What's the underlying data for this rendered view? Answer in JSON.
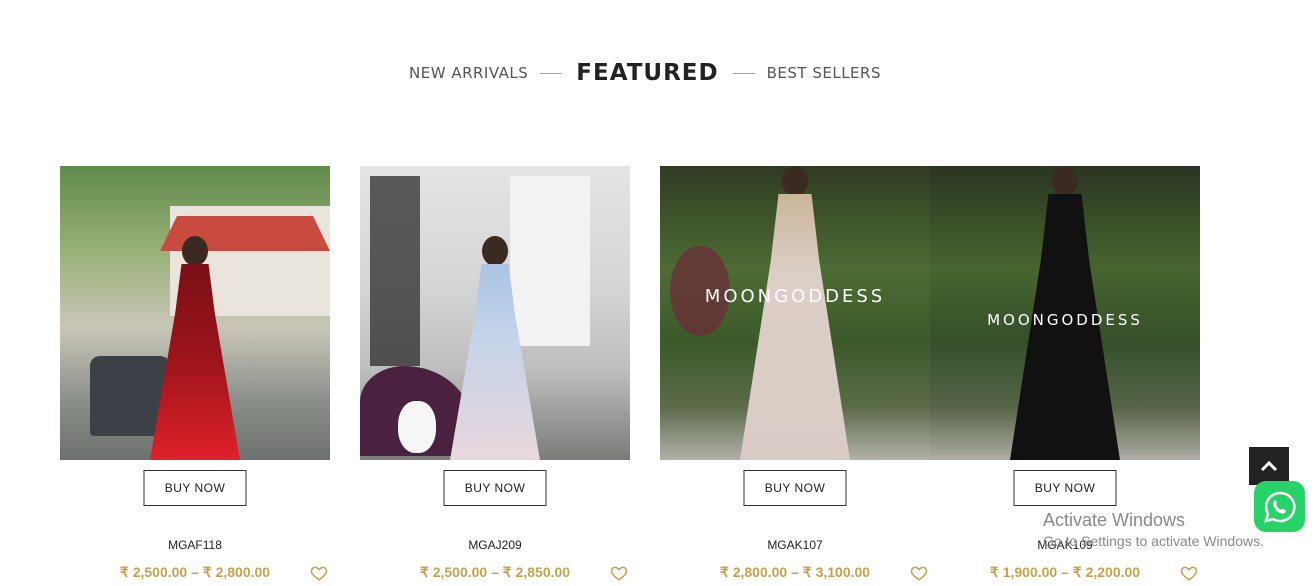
{
  "tabs": [
    {
      "label": "NEW ARRIVALS",
      "active": false
    },
    {
      "label": "FEATURED",
      "active": true
    },
    {
      "label": "BEST SELLERS",
      "active": false
    }
  ],
  "products": [
    {
      "sku": "MGAF118",
      "price": "₹ 2,500.00 – ₹ 2,800.00",
      "buy_label": "BUY NOW",
      "watermark": "",
      "dress_color": "#b8141c"
    },
    {
      "sku": "MGAJ209",
      "price": "₹ 2,500.00 – ₹ 2,850.00",
      "buy_label": "BUY NOW",
      "watermark": "",
      "dress_color": "#c9d7e8"
    },
    {
      "sku": "MGAK107",
      "price": "₹ 2,800.00 – ₹ 3,100.00",
      "buy_label": "BUY NOW",
      "watermark": "MOONGODDESS",
      "dress_color": "#d9ccc6"
    },
    {
      "sku": "MGAK109",
      "price": "₹ 1,900.00 – ₹ 2,200.00",
      "buy_label": "BUY NOW",
      "watermark": "MOONGODDESS",
      "dress_color": "#111111"
    }
  ],
  "overlay": {
    "activate_title": "Activate Windows",
    "activate_sub": "Go to Settings to activate Windows."
  },
  "colors": {
    "accent": "#c9a14a",
    "whatsapp": "#25d366"
  }
}
